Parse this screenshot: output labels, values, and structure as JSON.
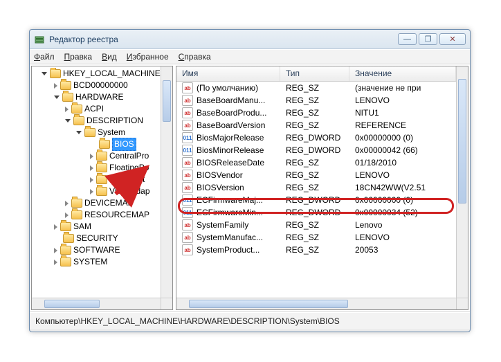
{
  "title": "Редактор реестра",
  "menubar": {
    "file": "Файл",
    "edit": "Правка",
    "view": "Вид",
    "fav": "Избранное",
    "help": "Справка"
  },
  "tree": {
    "root": "HKEY_LOCAL_MACHINE",
    "items": [
      {
        "indent": 28,
        "twist": "closed",
        "label": "BCD00000000"
      },
      {
        "indent": 28,
        "twist": "open",
        "label": "HARDWARE"
      },
      {
        "indent": 44,
        "twist": "closed",
        "label": "ACPI"
      },
      {
        "indent": 44,
        "twist": "open",
        "label": "DESCRIPTION"
      },
      {
        "indent": 60,
        "twist": "open",
        "label": "System"
      },
      {
        "indent": 80,
        "twist": "none",
        "label": "BIOS",
        "sel": true
      },
      {
        "indent": 80,
        "twist": "closed",
        "label": "CentralPro"
      },
      {
        "indent": 80,
        "twist": "closed",
        "label": "FloatingPo"
      },
      {
        "indent": 80,
        "twist": "closed",
        "label": "Multifunct"
      },
      {
        "indent": 80,
        "twist": "closed",
        "label": "VideoAdap"
      },
      {
        "indent": 44,
        "twist": "closed",
        "label": "DEVICEMAP"
      },
      {
        "indent": 44,
        "twist": "closed",
        "label": "RESOURCEMAP"
      },
      {
        "indent": 28,
        "twist": "closed",
        "label": "SAM"
      },
      {
        "indent": 28,
        "twist": "none",
        "label": "SECURITY"
      },
      {
        "indent": 28,
        "twist": "closed",
        "label": "SOFTWARE"
      },
      {
        "indent": 28,
        "twist": "closed",
        "label": "SYSTEM"
      }
    ]
  },
  "columns": {
    "name": "Имя",
    "type": "Тип",
    "value": "Значение"
  },
  "rows": [
    {
      "ico": "s",
      "name": "(По умолчанию)",
      "type": "REG_SZ",
      "value": "(значение не при"
    },
    {
      "ico": "s",
      "name": "BaseBoardManu...",
      "type": "REG_SZ",
      "value": "LENOVO"
    },
    {
      "ico": "s",
      "name": "BaseBoardProdu...",
      "type": "REG_SZ",
      "value": "NITU1"
    },
    {
      "ico": "s",
      "name": "BaseBoardVersion",
      "type": "REG_SZ",
      "value": "REFERENCE"
    },
    {
      "ico": "b",
      "name": "BiosMajorRelease",
      "type": "REG_DWORD",
      "value": "0x00000000 (0)"
    },
    {
      "ico": "b",
      "name": "BiosMinorRelease",
      "type": "REG_DWORD",
      "value": "0x00000042 (66)"
    },
    {
      "ico": "s",
      "name": "BIOSReleaseDate",
      "type": "REG_SZ",
      "value": "01/18/2010"
    },
    {
      "ico": "s",
      "name": "BIOSVendor",
      "type": "REG_SZ",
      "value": "LENOVO"
    },
    {
      "ico": "s",
      "name": "BIOSVersion",
      "type": "REG_SZ",
      "value": "18CN42WW(V2.51"
    },
    {
      "ico": "b",
      "name": "ECFirmwareMaj...",
      "type": "REG_DWORD",
      "value": "0x00000000 (0)"
    },
    {
      "ico": "b",
      "name": "ECFirmwareMin...",
      "type": "REG_DWORD",
      "value": "0x00000034 (52)"
    },
    {
      "ico": "s",
      "name": "SystemFamily",
      "type": "REG_SZ",
      "value": "Lenovo"
    },
    {
      "ico": "s",
      "name": "SystemManufac...",
      "type": "REG_SZ",
      "value": "LENOVO"
    },
    {
      "ico": "s",
      "name": "SystemProduct...",
      "type": "REG_SZ",
      "value": "20053"
    }
  ],
  "status": "Компьютер\\HKEY_LOCAL_MACHINE\\HARDWARE\\DESCRIPTION\\System\\BIOS",
  "glyph": {
    "ab": "ab",
    "bin": "011",
    "min": "—",
    "max": "❐",
    "close": "✕"
  }
}
